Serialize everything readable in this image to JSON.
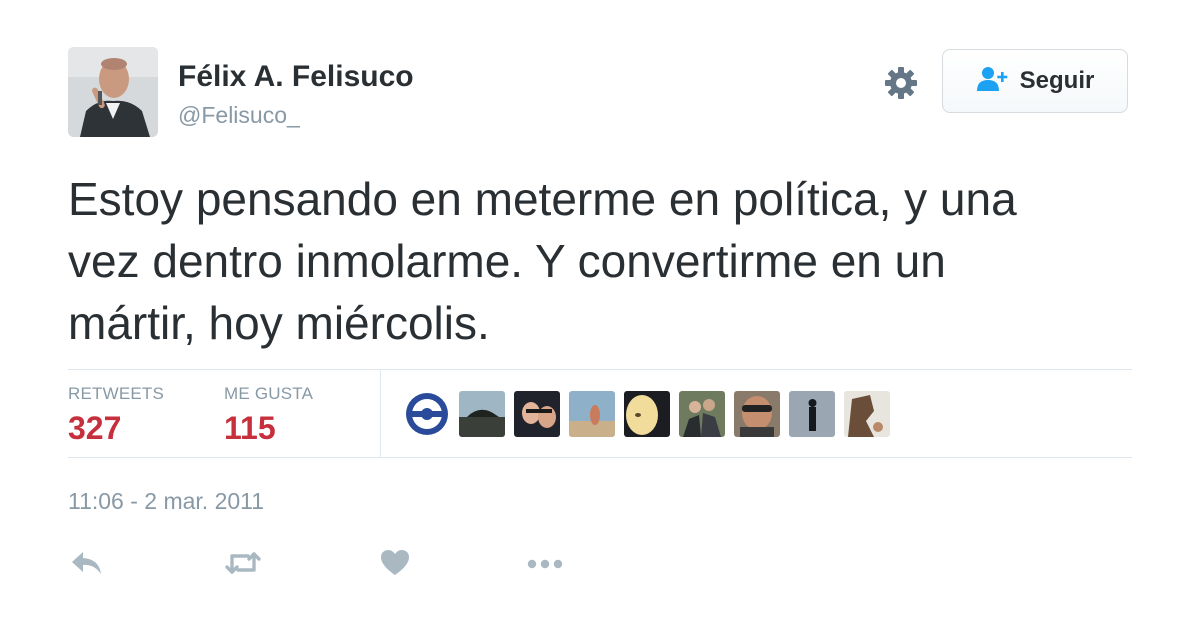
{
  "user": {
    "display_name": "Félix A. Felisuco",
    "handle": "@Felisuco_"
  },
  "follow_button": {
    "label": "Seguir",
    "icon": "add-user-icon"
  },
  "settings_icon": "gear-icon",
  "tweet": {
    "lines": [
      "Estoy pensando en meterme en política, y una",
      "vez dentro inmolarme. Y convertirme en un",
      "mártir, hoy miércolis."
    ]
  },
  "stats": {
    "retweets_label": "RETWEETS",
    "retweets_value": "327",
    "likes_label": "ME GUSTA",
    "likes_value": "115"
  },
  "liker_avatars_count": 9,
  "timestamp": "11:06 - 2 mar. 2011",
  "actions": [
    "reply-icon",
    "retweet-icon",
    "like-icon",
    "more-icon"
  ],
  "colors": {
    "text": "#292f33",
    "muted": "#8899a6",
    "stat_value": "#c5303c",
    "divider": "#e1e8ed",
    "icon": "#aab8c2",
    "follow_icon": "#1da1f2"
  }
}
